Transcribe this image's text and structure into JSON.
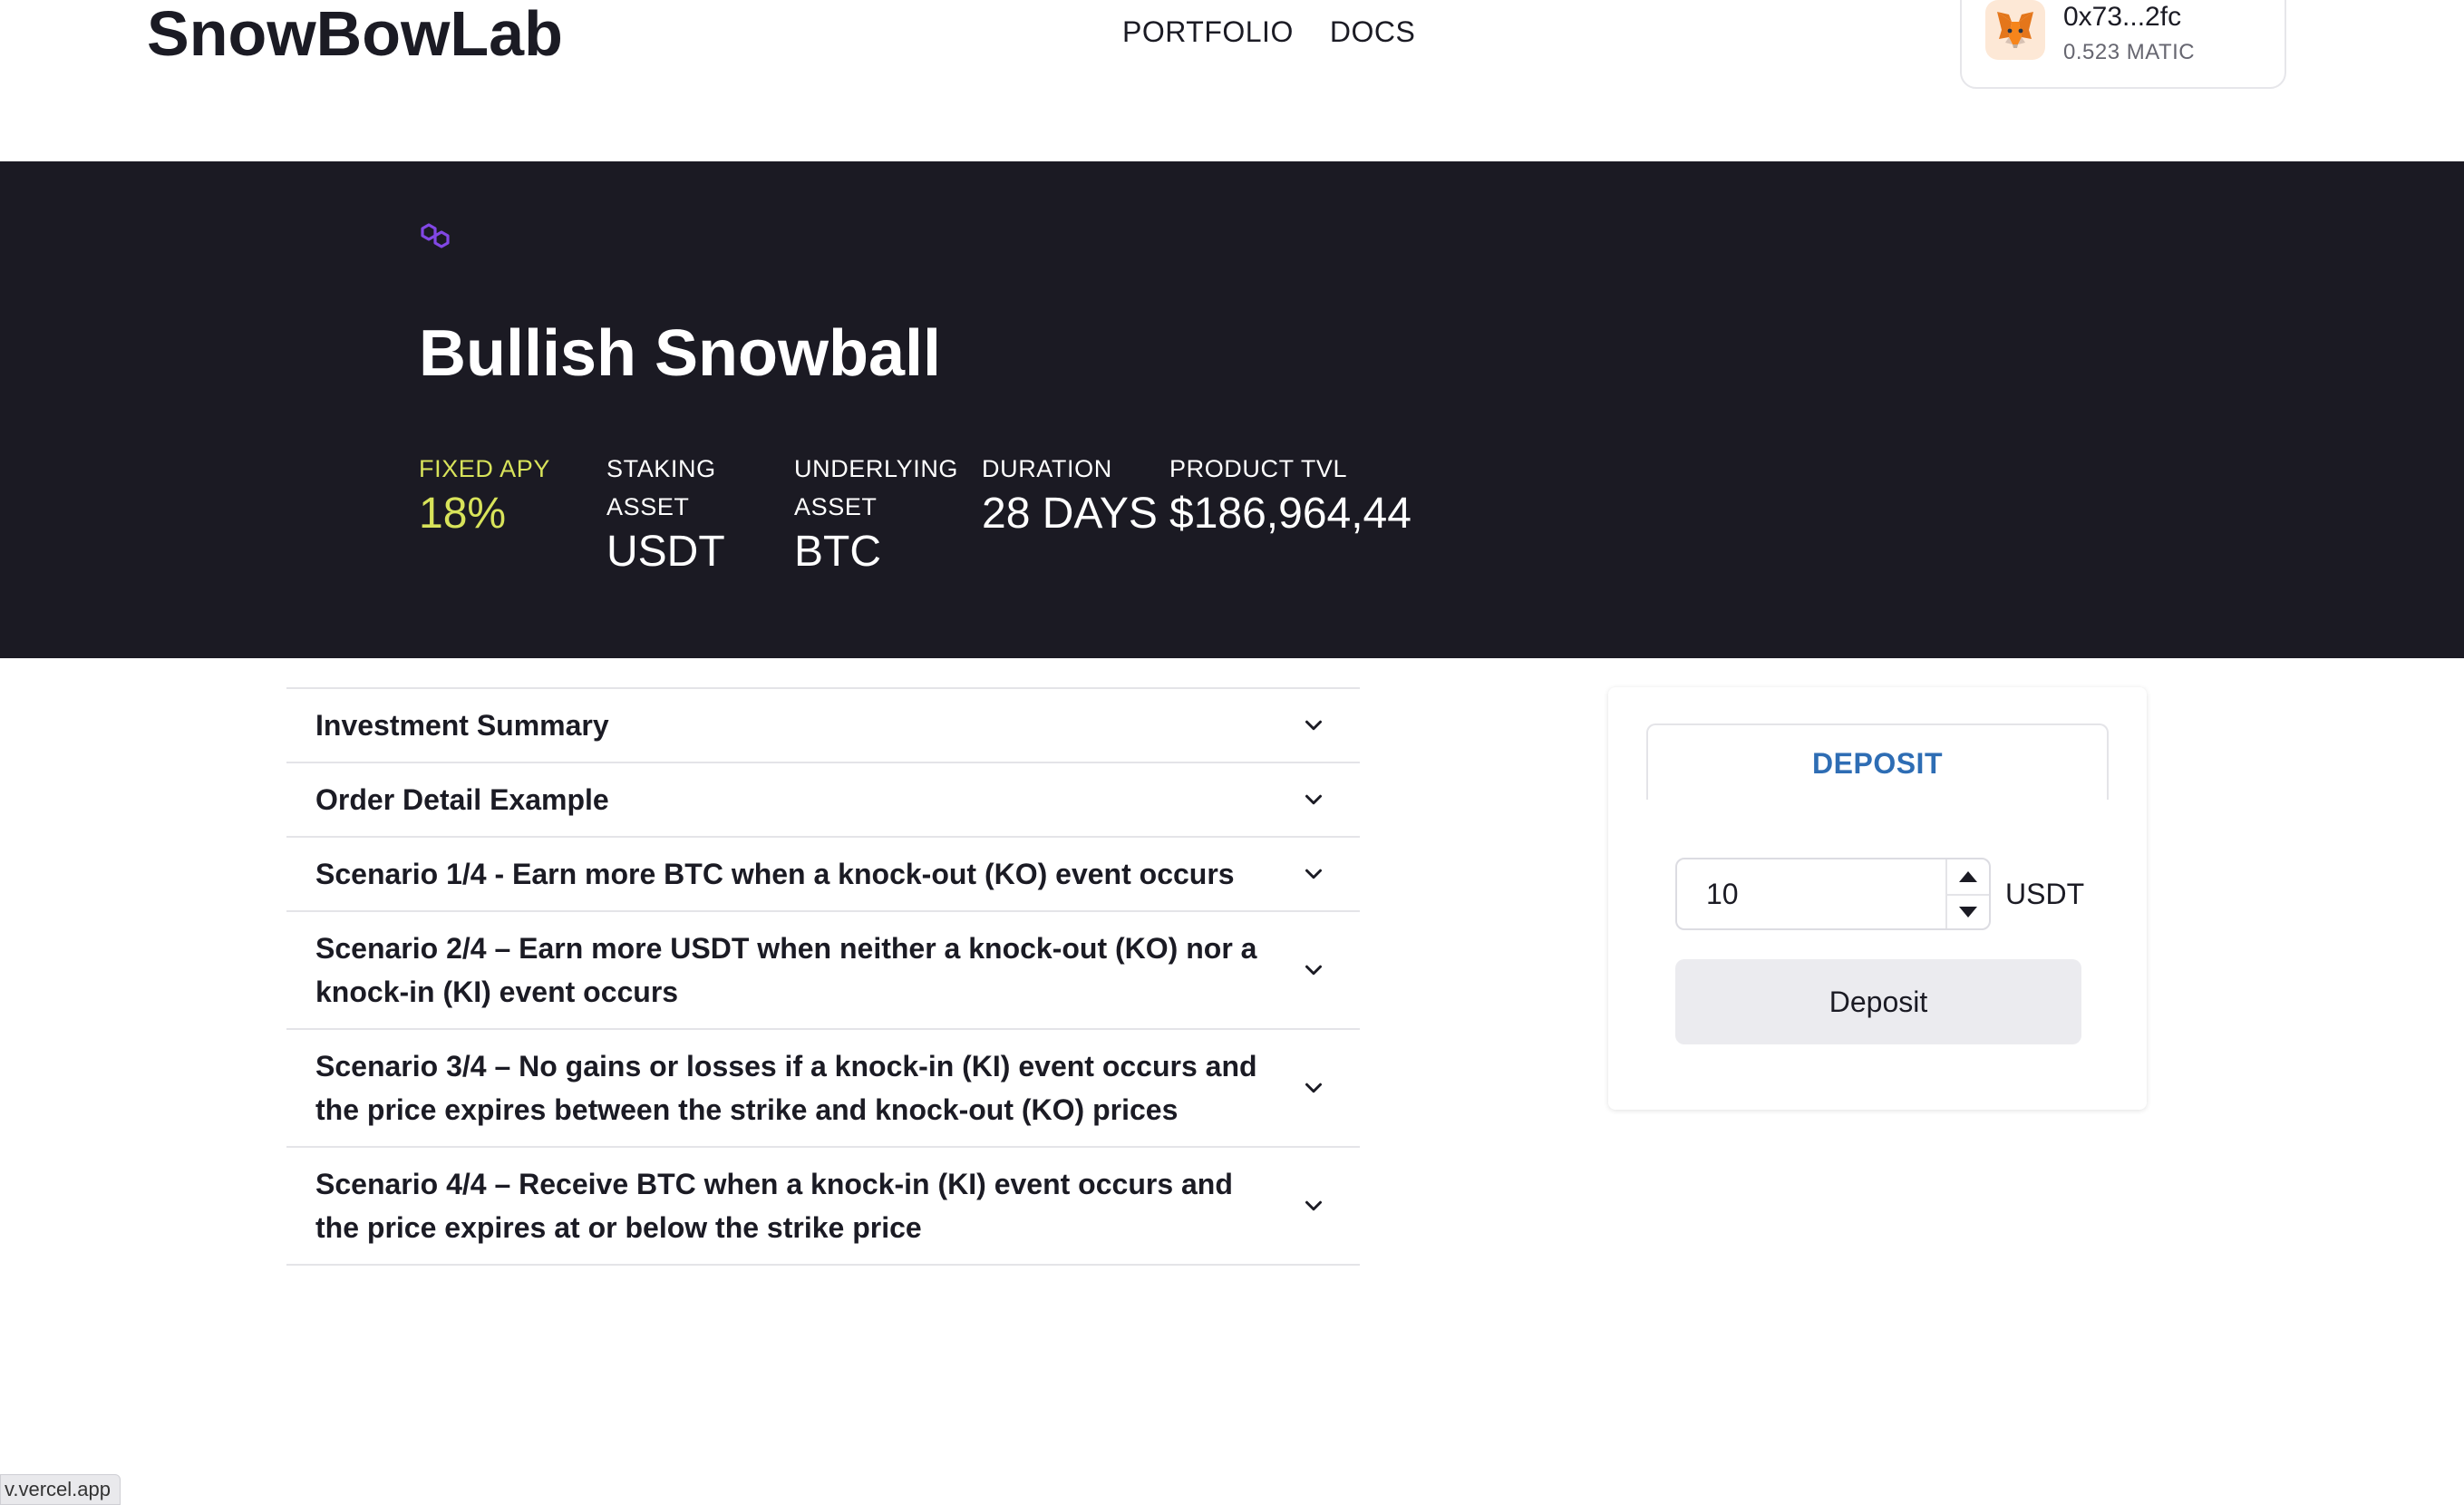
{
  "header": {
    "logo": "SnowBowLab",
    "nav": [
      "PORTFOLIO",
      "DOCS"
    ],
    "wallet": {
      "address": "0x73...2fc",
      "balance": "0.523 MATIC",
      "icon": "metamask-fox-icon"
    }
  },
  "hero": {
    "chain_icon": "polygon-icon",
    "title": "Bullish Snowball",
    "stats": [
      {
        "label": "FIXED APY",
        "value": "18%"
      },
      {
        "label_line1": "STAKING",
        "label_line2": "ASSET",
        "value": "USDT"
      },
      {
        "label_line1": "UNDERLYING",
        "label_line2": "ASSET",
        "value": "BTC"
      },
      {
        "label": "DURATION",
        "value": "28 DAYS"
      },
      {
        "label": "PRODUCT TVL",
        "value": "$186,964,44"
      }
    ],
    "accent_color": "#d8e35a",
    "background": "#1b1a23"
  },
  "accordion": [
    {
      "title": "Investment Summary"
    },
    {
      "title": "Order Detail Example"
    },
    {
      "title": "Scenario 1/4 - Earn more BTC when a knock-out (KO) event occurs"
    },
    {
      "title": "Scenario 2/4 – Earn more USDT when neither a knock-out (KO) nor a knock-in (KI) event occurs"
    },
    {
      "title": "Scenario 3/4 – No gains or losses if a knock-in (KI) event occurs and the price expires between the strike and knock-out (KO) prices"
    },
    {
      "title": "Scenario 4/4 – Receive BTC when a knock-in (KI) event occurs and the price expires at or below the strike price"
    }
  ],
  "deposit": {
    "tab_label": "DEPOSIT",
    "amount_value": "10",
    "unit": "USDT",
    "button_label": "Deposit",
    "accent_color": "#2e6db4"
  },
  "status_url": "v.vercel.app"
}
